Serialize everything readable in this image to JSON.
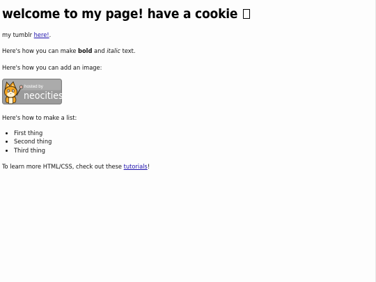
{
  "title": "welcome to my page! have a cookie",
  "tumblr": {
    "prefix": "my tumblr ",
    "link": "here!",
    "suffix": "."
  },
  "formatting": {
    "prefix": "Here's how you can make ",
    "bold": "bold",
    "middle": " and ",
    "italic": "italic",
    "suffix": " text."
  },
  "image_intro": "Here's how you can add an image:",
  "badge": {
    "small_text": "hosted by",
    "big_text": "neocities"
  },
  "list_intro": "Here's how to make a list:",
  "list_items": [
    "First thing",
    "Second thing",
    "Third thing"
  ],
  "learn": {
    "prefix": "To learn more HTML/CSS, check out these ",
    "link": "tutorials",
    "suffix": "!"
  },
  "colors": {
    "link": "#1a0dab",
    "background": "#fdfdfd",
    "badge_bg": "#9b9b9b",
    "cat_orange": "#f5a623"
  }
}
